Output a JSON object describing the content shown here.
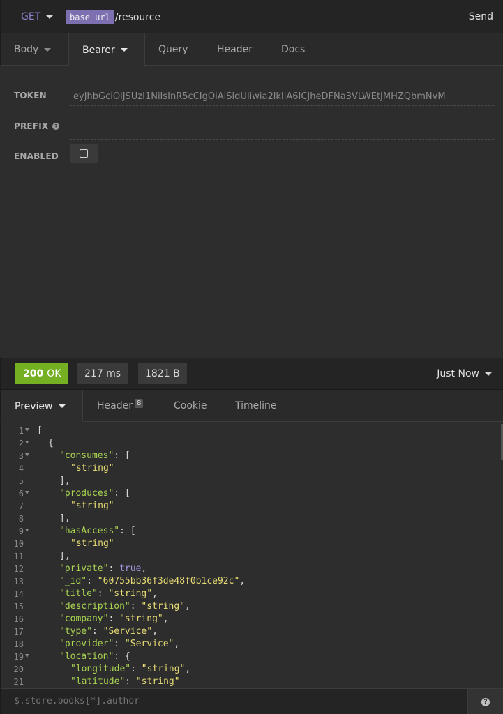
{
  "url_bar": {
    "method": "GET",
    "var_tag": "base_url",
    "path": "/resource",
    "send_label": "Send"
  },
  "request_tabs": [
    {
      "label": "Body",
      "has_caret": true
    },
    {
      "label": "Bearer",
      "has_caret": true,
      "active": true
    },
    {
      "label": "Query"
    },
    {
      "label": "Header"
    },
    {
      "label": "Docs"
    }
  ],
  "auth_form": {
    "token_label": "TOKEN",
    "token_value": "eyJhbGciOiJSUzI1NiIsInR5cCIgOiAiSldUIiwia2lkIiA6ICJheDFNa3VLWEtJMHZQbmNvM",
    "prefix_label": "PREFIX",
    "prefix_value": "",
    "enabled_label": "ENABLED",
    "enabled": false
  },
  "status_bar": {
    "status_code": "200",
    "status_text": "OK",
    "time": "217 ms",
    "size": "1821 B",
    "history_label": "Just Now"
  },
  "response_tabs": [
    {
      "label": "Preview",
      "has_caret": true,
      "active": true
    },
    {
      "label": "Header",
      "badge": "8"
    },
    {
      "label": "Cookie"
    },
    {
      "label": "Timeline"
    }
  ],
  "response_lines": [
    {
      "n": "1",
      "fold": true,
      "indent": 0,
      "parts": [
        [
          "p",
          "["
        ]
      ]
    },
    {
      "n": "2",
      "fold": true,
      "indent": 1,
      "parts": [
        [
          "p",
          "{"
        ]
      ]
    },
    {
      "n": "3",
      "fold": true,
      "indent": 2,
      "parts": [
        [
          "k",
          "\"consumes\""
        ],
        [
          "p",
          ": ["
        ]
      ]
    },
    {
      "n": "4",
      "indent": 3,
      "parts": [
        [
          "s",
          "\"string\""
        ]
      ]
    },
    {
      "n": "5",
      "indent": 2,
      "parts": [
        [
          "p",
          "],"
        ]
      ]
    },
    {
      "n": "6",
      "fold": true,
      "indent": 2,
      "parts": [
        [
          "k",
          "\"produces\""
        ],
        [
          "p",
          ": ["
        ]
      ]
    },
    {
      "n": "7",
      "indent": 3,
      "parts": [
        [
          "s",
          "\"string\""
        ]
      ]
    },
    {
      "n": "8",
      "indent": 2,
      "parts": [
        [
          "p",
          "],"
        ]
      ]
    },
    {
      "n": "9",
      "fold": true,
      "indent": 2,
      "parts": [
        [
          "k",
          "\"hasAccess\""
        ],
        [
          "p",
          ": ["
        ]
      ]
    },
    {
      "n": "10",
      "indent": 3,
      "parts": [
        [
          "s",
          "\"string\""
        ]
      ]
    },
    {
      "n": "11",
      "indent": 2,
      "parts": [
        [
          "p",
          "],"
        ]
      ]
    },
    {
      "n": "12",
      "indent": 2,
      "parts": [
        [
          "k",
          "\"private\""
        ],
        [
          "p",
          ": "
        ],
        [
          "b",
          "true"
        ],
        [
          "p",
          ","
        ]
      ]
    },
    {
      "n": "13",
      "indent": 2,
      "parts": [
        [
          "k",
          "\"_id\""
        ],
        [
          "p",
          ": "
        ],
        [
          "s",
          "\"60755bb36f3de48f0b1ce92c\""
        ],
        [
          "p",
          ","
        ]
      ]
    },
    {
      "n": "14",
      "indent": 2,
      "parts": [
        [
          "k",
          "\"title\""
        ],
        [
          "p",
          ": "
        ],
        [
          "s",
          "\"string\""
        ],
        [
          "p",
          ","
        ]
      ]
    },
    {
      "n": "15",
      "indent": 2,
      "parts": [
        [
          "k",
          "\"description\""
        ],
        [
          "p",
          ": "
        ],
        [
          "s",
          "\"string\""
        ],
        [
          "p",
          ","
        ]
      ]
    },
    {
      "n": "16",
      "indent": 2,
      "parts": [
        [
          "k",
          "\"company\""
        ],
        [
          "p",
          ": "
        ],
        [
          "s",
          "\"string\""
        ],
        [
          "p",
          ","
        ]
      ]
    },
    {
      "n": "17",
      "indent": 2,
      "parts": [
        [
          "k",
          "\"type\""
        ],
        [
          "p",
          ": "
        ],
        [
          "s",
          "\"Service\""
        ],
        [
          "p",
          ","
        ]
      ]
    },
    {
      "n": "18",
      "indent": 2,
      "parts": [
        [
          "k",
          "\"provider\""
        ],
        [
          "p",
          ": "
        ],
        [
          "s",
          "\"Service\""
        ],
        [
          "p",
          ","
        ]
      ]
    },
    {
      "n": "19",
      "fold": true,
      "indent": 2,
      "parts": [
        [
          "k",
          "\"location\""
        ],
        [
          "p",
          ": {"
        ]
      ]
    },
    {
      "n": "20",
      "indent": 3,
      "parts": [
        [
          "k",
          "\"longitude\""
        ],
        [
          "p",
          ": "
        ],
        [
          "s",
          "\"string\""
        ],
        [
          "p",
          ","
        ]
      ]
    },
    {
      "n": "21",
      "indent": 3,
      "parts": [
        [
          "k",
          "\"latitude\""
        ],
        [
          "p",
          ": "
        ],
        [
          "s",
          "\"string\""
        ]
      ]
    }
  ],
  "filter": {
    "placeholder": "$.store.books[*].author"
  },
  "icons": {
    "fold": "fold-triangle-icon",
    "help": "question-circle-icon",
    "dropdown": "caret-down-icon"
  },
  "colors": {
    "status_ok": "#75b023",
    "method": "#8c82ce",
    "json_key": "#a9d451",
    "json_string": "#e6db74",
    "json_bool": "#a795e0",
    "var_tag": "#7d6fb0"
  }
}
